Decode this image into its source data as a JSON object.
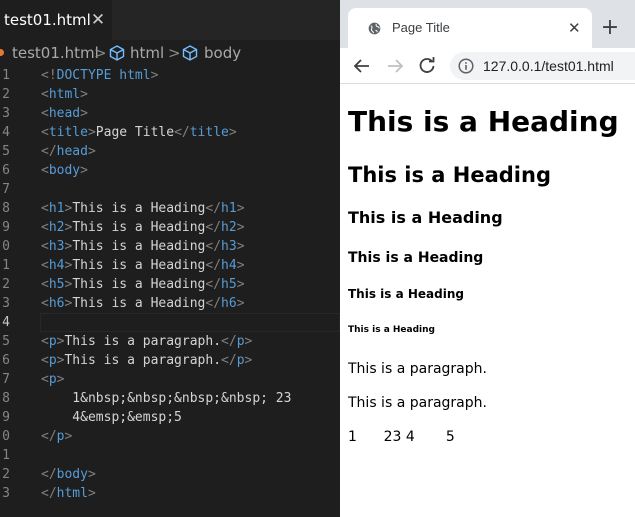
{
  "editor": {
    "tab": {
      "label": "test01.html",
      "close": "✕"
    },
    "breadcrumb": {
      "file": "test01.html",
      "sep": ">",
      "node1": "html",
      "node2": "body"
    },
    "current_line": 11,
    "lines": [
      {
        "num": "1",
        "tokens": [
          [
            "br",
            "<!"
          ],
          [
            "tag",
            "DOCTYPE"
          ],
          [
            "txt",
            " "
          ],
          [
            "tag",
            "html"
          ],
          [
            "br",
            ">"
          ]
        ]
      },
      {
        "num": "2",
        "tokens": [
          [
            "br",
            "<"
          ],
          [
            "tag",
            "html"
          ],
          [
            "br",
            ">"
          ]
        ]
      },
      {
        "num": "3",
        "tokens": [
          [
            "br",
            "<"
          ],
          [
            "tag",
            "head"
          ],
          [
            "br",
            ">"
          ]
        ]
      },
      {
        "num": "4",
        "tokens": [
          [
            "br",
            "<"
          ],
          [
            "tag",
            "title"
          ],
          [
            "br",
            ">"
          ],
          [
            "txt",
            "Page Title"
          ],
          [
            "br",
            "</"
          ],
          [
            "tag",
            "title"
          ],
          [
            "br",
            ">"
          ]
        ]
      },
      {
        "num": "5",
        "tokens": [
          [
            "br",
            "</"
          ],
          [
            "tag",
            "head"
          ],
          [
            "br",
            ">"
          ]
        ]
      },
      {
        "num": "6",
        "tokens": [
          [
            "br",
            "<"
          ],
          [
            "tag",
            "body"
          ],
          [
            "br",
            ">"
          ]
        ]
      },
      {
        "num": "7",
        "tokens": []
      },
      {
        "num": "8",
        "tokens": [
          [
            "br",
            "<"
          ],
          [
            "tag",
            "h1"
          ],
          [
            "br",
            ">"
          ],
          [
            "txt",
            "This is a Heading"
          ],
          [
            "br",
            "</"
          ],
          [
            "tag",
            "h1"
          ],
          [
            "br",
            ">"
          ]
        ]
      },
      {
        "num": "9",
        "tokens": [
          [
            "br",
            "<"
          ],
          [
            "tag",
            "h2"
          ],
          [
            "br",
            ">"
          ],
          [
            "txt",
            "This is a Heading"
          ],
          [
            "br",
            "</"
          ],
          [
            "tag",
            "h2"
          ],
          [
            "br",
            ">"
          ]
        ]
      },
      {
        "num": "0",
        "tokens": [
          [
            "br",
            "<"
          ],
          [
            "tag",
            "h3"
          ],
          [
            "br",
            ">"
          ],
          [
            "txt",
            "This is a Heading"
          ],
          [
            "br",
            "</"
          ],
          [
            "tag",
            "h3"
          ],
          [
            "br",
            ">"
          ]
        ]
      },
      {
        "num": "1",
        "tokens": [
          [
            "br",
            "<"
          ],
          [
            "tag",
            "h4"
          ],
          [
            "br",
            ">"
          ],
          [
            "txt",
            "This is a Heading"
          ],
          [
            "br",
            "</"
          ],
          [
            "tag",
            "h4"
          ],
          [
            "br",
            ">"
          ]
        ]
      },
      {
        "num": "2",
        "tokens": [
          [
            "br",
            "<"
          ],
          [
            "tag",
            "h5"
          ],
          [
            "br",
            ">"
          ],
          [
            "txt",
            "This is a Heading"
          ],
          [
            "br",
            "</"
          ],
          [
            "tag",
            "h5"
          ],
          [
            "br",
            ">"
          ]
        ]
      },
      {
        "num": "3",
        "tokens": [
          [
            "br",
            "<"
          ],
          [
            "tag",
            "h6"
          ],
          [
            "br",
            ">"
          ],
          [
            "txt",
            "This is a Heading"
          ],
          [
            "br",
            "</"
          ],
          [
            "tag",
            "h6"
          ],
          [
            "br",
            ">"
          ]
        ]
      },
      {
        "num": "4",
        "tokens": []
      },
      {
        "num": "5",
        "tokens": [
          [
            "br",
            "<"
          ],
          [
            "tag",
            "p"
          ],
          [
            "br",
            ">"
          ],
          [
            "txt",
            "This is a paragraph."
          ],
          [
            "br",
            "</"
          ],
          [
            "tag",
            "p"
          ],
          [
            "br",
            ">"
          ]
        ]
      },
      {
        "num": "6",
        "tokens": [
          [
            "br",
            "<"
          ],
          [
            "tag",
            "p"
          ],
          [
            "br",
            ">"
          ],
          [
            "txt",
            "This is a paragraph."
          ],
          [
            "br",
            "</"
          ],
          [
            "tag",
            "p"
          ],
          [
            "br",
            ">"
          ]
        ]
      },
      {
        "num": "7",
        "tokens": [
          [
            "br",
            "<"
          ],
          [
            "tag",
            "p"
          ],
          [
            "br",
            ">"
          ]
        ]
      },
      {
        "num": "8",
        "tokens": [
          [
            "txt",
            "    1&nbsp;&nbsp;&nbsp;&nbsp; 23"
          ]
        ]
      },
      {
        "num": "9",
        "tokens": [
          [
            "txt",
            "    4&emsp;&emsp;5"
          ]
        ]
      },
      {
        "num": "0",
        "tokens": [
          [
            "br",
            "</"
          ],
          [
            "tag",
            "p"
          ],
          [
            "br",
            ">"
          ]
        ]
      },
      {
        "num": "1",
        "tokens": []
      },
      {
        "num": "2",
        "tokens": [
          [
            "br",
            "</"
          ],
          [
            "tag",
            "body"
          ],
          [
            "br",
            ">"
          ]
        ]
      },
      {
        "num": "3",
        "tokens": [
          [
            "br",
            "</"
          ],
          [
            "tag",
            "html"
          ],
          [
            "br",
            ">"
          ]
        ]
      }
    ]
  },
  "browser": {
    "tab_title": "Page Title",
    "tab_close": "✕",
    "new_tab": "+",
    "url": "127.0.0.1/test01.html",
    "page": {
      "h1": "This is a Heading",
      "h2": "This is a Heading",
      "h3": "This is a Heading",
      "h4": "This is a Heading",
      "h5": "This is a Heading",
      "h6": "This is a Heading",
      "p1": "This is a paragraph.",
      "p2": "This is a paragraph.",
      "p3": "1      23 4       5"
    }
  }
}
